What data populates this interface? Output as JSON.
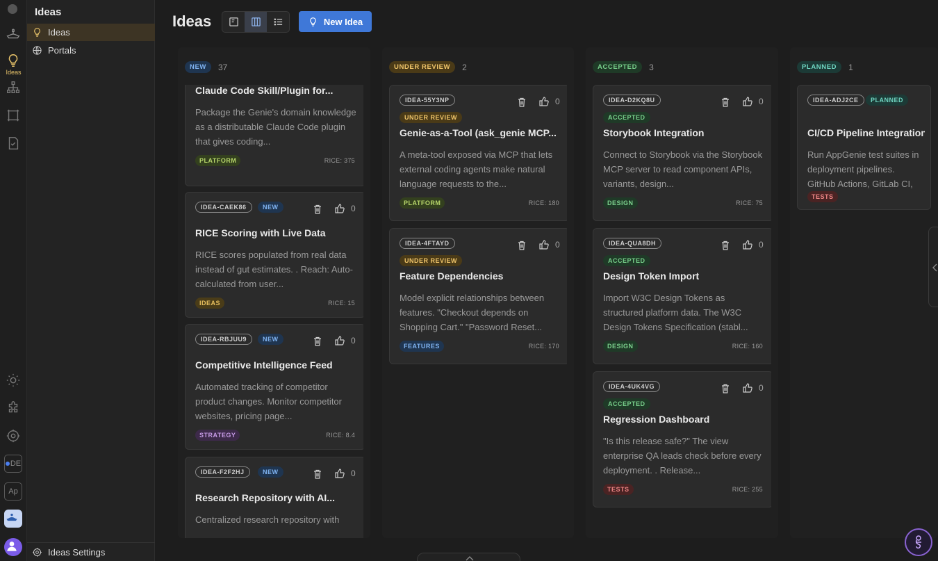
{
  "rail": {
    "active_label": "Ideas",
    "badge_de": "DE",
    "badge_ap": "Ap"
  },
  "sidebar": {
    "title": "Ideas",
    "items": [
      {
        "label": "Ideas",
        "icon": "lightbulb-icon",
        "active": true
      },
      {
        "label": "Portals",
        "icon": "globe-icon",
        "active": false
      }
    ],
    "footer": {
      "label": "Ideas Settings",
      "icon": "gear-icon"
    }
  },
  "header": {
    "title": "Ideas",
    "new_button": "New Idea",
    "views": [
      "card-view-icon",
      "board-view-icon",
      "list-view-icon"
    ],
    "active_view": "board"
  },
  "columns": [
    {
      "status": "NEW",
      "count": "37",
      "cards": [
        {
          "id": "",
          "status": "",
          "title": "Claude Code Skill/Plugin for...",
          "description": "Package the Genie's domain knowledge as a distributable Claude Code plugin that gives coding...",
          "tag": "PLATFORM",
          "tag_class": "t-platform",
          "rice": "RICE: 375",
          "votes": ""
        },
        {
          "id": "IDEA-CAEK86",
          "status": "NEW",
          "title": "RICE Scoring with Live Data",
          "description": "RICE scores populated from real data instead of gut estimates. . Reach: Auto-calculated from user...",
          "tag": "IDEAS",
          "tag_class": "t-ideas",
          "rice": "RICE: 15",
          "votes": "0"
        },
        {
          "id": "IDEA-RBJUU9",
          "status": "NEW",
          "title": "Competitive Intelligence Feed",
          "description": "Automated tracking of competitor product changes. Monitor competitor websites, pricing page...",
          "tag": "STRATEGY",
          "tag_class": "t-strategy",
          "rice": "RICE: 8.4",
          "votes": "0"
        },
        {
          "id": "IDEA-F2F2HJ",
          "status": "NEW",
          "title": "Research Repository with AI...",
          "description": "Centralized research repository with",
          "tag": "",
          "tag_class": "",
          "rice": "",
          "votes": "0"
        }
      ]
    },
    {
      "status": "UNDER REVIEW",
      "count": "2",
      "cards": [
        {
          "id": "IDEA-55Y3NP",
          "status": "UNDER REVIEW",
          "title": "Genie-as-a-Tool (ask_genie MCP...",
          "description": "A meta-tool exposed via MCP that lets external coding agents make natural language requests to the...",
          "tag": "PLATFORM",
          "tag_class": "t-platform",
          "rice": "RICE: 180",
          "votes": "0"
        },
        {
          "id": "IDEA-4FTAYD",
          "status": "UNDER REVIEW",
          "title": "Feature Dependencies",
          "description": "Model explicit relationships between features. \"Checkout depends on Shopping Cart.\" \"Password Reset...",
          "tag": "FEATURES",
          "tag_class": "t-features",
          "rice": "RICE: 170",
          "votes": "0"
        }
      ]
    },
    {
      "status": "ACCEPTED",
      "count": "3",
      "cards": [
        {
          "id": "IDEA-D2KQ8U",
          "status": "ACCEPTED",
          "title": "Storybook Integration",
          "description": "Connect to Storybook via the Storybook MCP server to read component APIs, variants, design...",
          "tag": "DESIGN",
          "tag_class": "t-design",
          "rice": "RICE: 75",
          "votes": "0"
        },
        {
          "id": "IDEA-QUA8DH",
          "status": "ACCEPTED",
          "title": "Design Token Import",
          "description": "Import W3C Design Tokens as structured platform data. The W3C Design Tokens Specification (stabl...",
          "tag": "DESIGN",
          "tag_class": "t-design",
          "rice": "RICE: 160",
          "votes": "0"
        },
        {
          "id": "IDEA-4UK4VG",
          "status": "ACCEPTED",
          "title": "Regression Dashboard",
          "description": "\"Is this release safe?\" The view enterprise QA leads check before every deployment. . Release...",
          "tag": "TESTS",
          "tag_class": "t-tests",
          "rice": "RICE: 255",
          "votes": "0"
        }
      ]
    },
    {
      "status": "PLANNED",
      "count": "1",
      "cards": [
        {
          "id": "IDEA-ADJ2CE",
          "status": "PLANNED",
          "title": "CI/CD Pipeline Integration",
          "description": "Run AppGenie test suites in deployment pipelines. GitHub Actions, GitLab CI, Jenkins",
          "tag": "TESTS",
          "tag_class": "t-tests",
          "rice": "",
          "votes": ""
        }
      ]
    }
  ]
}
